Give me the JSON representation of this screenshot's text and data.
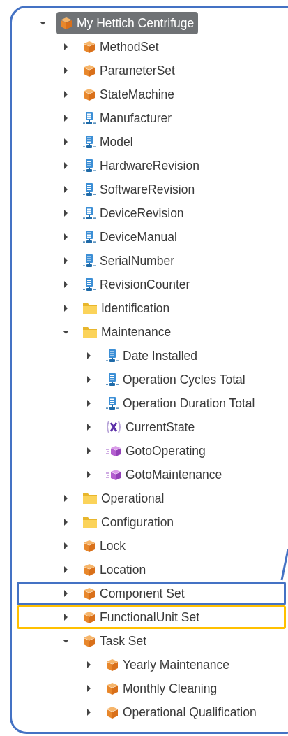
{
  "tree": [
    {
      "label": "My Hettich Centrifuge",
      "kind": "object",
      "expanded": true,
      "selected": true,
      "children": [
        {
          "label": "MethodSet",
          "kind": "object",
          "expanded": false,
          "selected": false
        },
        {
          "label": "ParameterSet",
          "kind": "object",
          "expanded": false,
          "selected": false
        },
        {
          "label": "StateMachine",
          "kind": "object",
          "expanded": false,
          "selected": false
        },
        {
          "label": "Manufacturer",
          "kind": "variable",
          "expanded": false,
          "selected": false
        },
        {
          "label": "Model",
          "kind": "variable",
          "expanded": false,
          "selected": false
        },
        {
          "label": "HardwareRevision",
          "kind": "variable",
          "expanded": false,
          "selected": false
        },
        {
          "label": "SoftwareRevision",
          "kind": "variable",
          "expanded": false,
          "selected": false
        },
        {
          "label": "DeviceRevision",
          "kind": "variable",
          "expanded": false,
          "selected": false
        },
        {
          "label": "DeviceManual",
          "kind": "variable",
          "expanded": false,
          "selected": false
        },
        {
          "label": "SerialNumber",
          "kind": "variable",
          "expanded": false,
          "selected": false
        },
        {
          "label": "RevisionCounter",
          "kind": "variable",
          "expanded": false,
          "selected": false
        },
        {
          "label": "Identification",
          "kind": "folder",
          "expanded": false,
          "selected": false
        },
        {
          "label": "Maintenance",
          "kind": "folder",
          "expanded": true,
          "selected": false,
          "children": [
            {
              "label": "Date Installed",
              "kind": "variable",
              "expanded": false,
              "selected": false
            },
            {
              "label": "Operation Cycles Total",
              "kind": "variable",
              "expanded": false,
              "selected": false
            },
            {
              "label": "Operation Duration Total",
              "kind": "variable",
              "expanded": false,
              "selected": false
            },
            {
              "label": "CurrentState",
              "kind": "state",
              "expanded": false,
              "selected": false
            },
            {
              "label": "GotoOperating",
              "kind": "method",
              "expanded": false,
              "selected": false
            },
            {
              "label": "GotoMaintenance",
              "kind": "method",
              "expanded": false,
              "selected": false
            }
          ]
        },
        {
          "label": "Operational",
          "kind": "folder",
          "expanded": false,
          "selected": false
        },
        {
          "label": "Configuration",
          "kind": "folder",
          "expanded": false,
          "selected": false
        },
        {
          "label": "Lock",
          "kind": "object",
          "expanded": false,
          "selected": false
        },
        {
          "label": "Location",
          "kind": "object",
          "expanded": false,
          "selected": false
        },
        {
          "label": "Component Set",
          "kind": "object",
          "expanded": false,
          "selected": false,
          "color": "#4472c4"
        },
        {
          "label": "FunctionalUnit Set",
          "kind": "object",
          "expanded": false,
          "selected": false,
          "color": "#ffc000"
        },
        {
          "label": "Task Set",
          "kind": "object",
          "expanded": true,
          "selected": false,
          "children": [
            {
              "label": "Yearly Maintenance",
              "kind": "object",
              "expanded": false,
              "selected": false
            },
            {
              "label": "Monthly Cleaning",
              "kind": "object",
              "expanded": false,
              "selected": false
            },
            {
              "label": "Operational Qualification",
              "kind": "object",
              "expanded": false,
              "selected": false
            }
          ]
        }
      ]
    }
  ]
}
